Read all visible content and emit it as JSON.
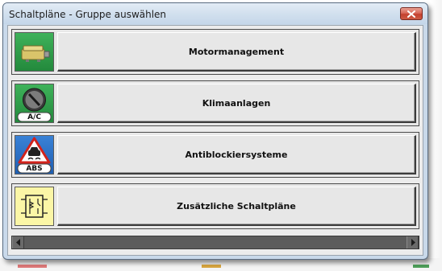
{
  "window": {
    "title": "Schaltpläne - Gruppe auswählen"
  },
  "groups": [
    {
      "label": "Motormanagement",
      "icon": "engine-ecu-icon",
      "icon_bg": "#2e9e4a"
    },
    {
      "label": "Klimaanlagen",
      "icon": "ac-knob-icon",
      "icon_bg": "#2e9e4a"
    },
    {
      "label": "Antiblockiersysteme",
      "icon": "abs-warning-icon",
      "icon_bg": "#2d6fc4"
    },
    {
      "label": "Zusätzliche Schaltpläne",
      "icon": "relay-diagram-icon",
      "icon_bg": "#fbf6a6"
    }
  ],
  "icon_text": {
    "ac": "A/C",
    "abs": "ABS"
  },
  "colors": {
    "title_bg": "#d2e0ee",
    "close_red": "#c4412f",
    "client_bg": "#ececec",
    "scrollbar": "#5c5c5c"
  }
}
